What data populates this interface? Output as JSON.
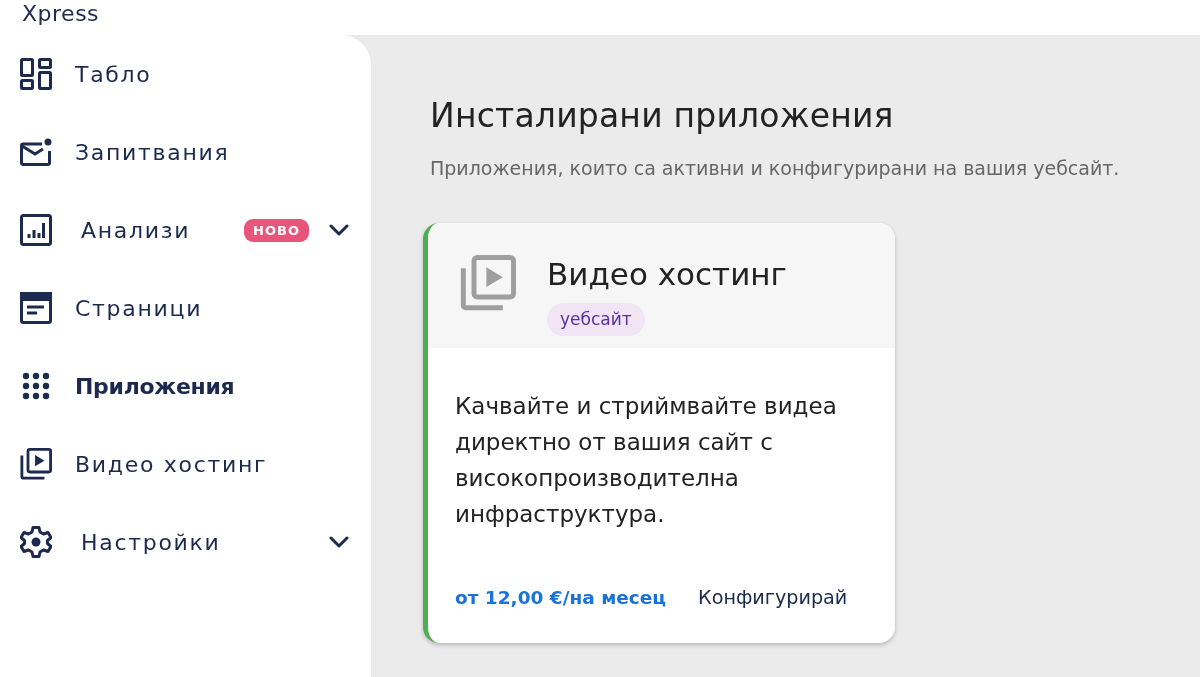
{
  "brand": {
    "name": "Xpress"
  },
  "sidebar": {
    "items": [
      {
        "label": "Табло",
        "selected": false,
        "expandable": false
      },
      {
        "label": "Запитвания",
        "selected": false,
        "expandable": false
      },
      {
        "label": "Анализи",
        "selected": false,
        "expandable": true,
        "badge": "НОВО"
      },
      {
        "label": "Страници",
        "selected": false,
        "expandable": false
      },
      {
        "label": "Приложения",
        "selected": true,
        "expandable": false
      },
      {
        "label": "Видео хостинг",
        "selected": false,
        "expandable": false
      },
      {
        "label": "Настройки",
        "selected": false,
        "expandable": true
      }
    ]
  },
  "main": {
    "title": "Инсталирани приложения",
    "subtitle": "Приложения, които са активни и конфигурирани на вашия уебсайт.",
    "apps": [
      {
        "title": "Видео хостинг",
        "tag": "уебсайт",
        "active": true,
        "description": "Качвайте и стриймвайте видеа директно от вашия сайт с високопроизводителна инфраструктура.",
        "price": "от 12,00 €/на месец",
        "action": "Конфигурирай"
      }
    ]
  }
}
